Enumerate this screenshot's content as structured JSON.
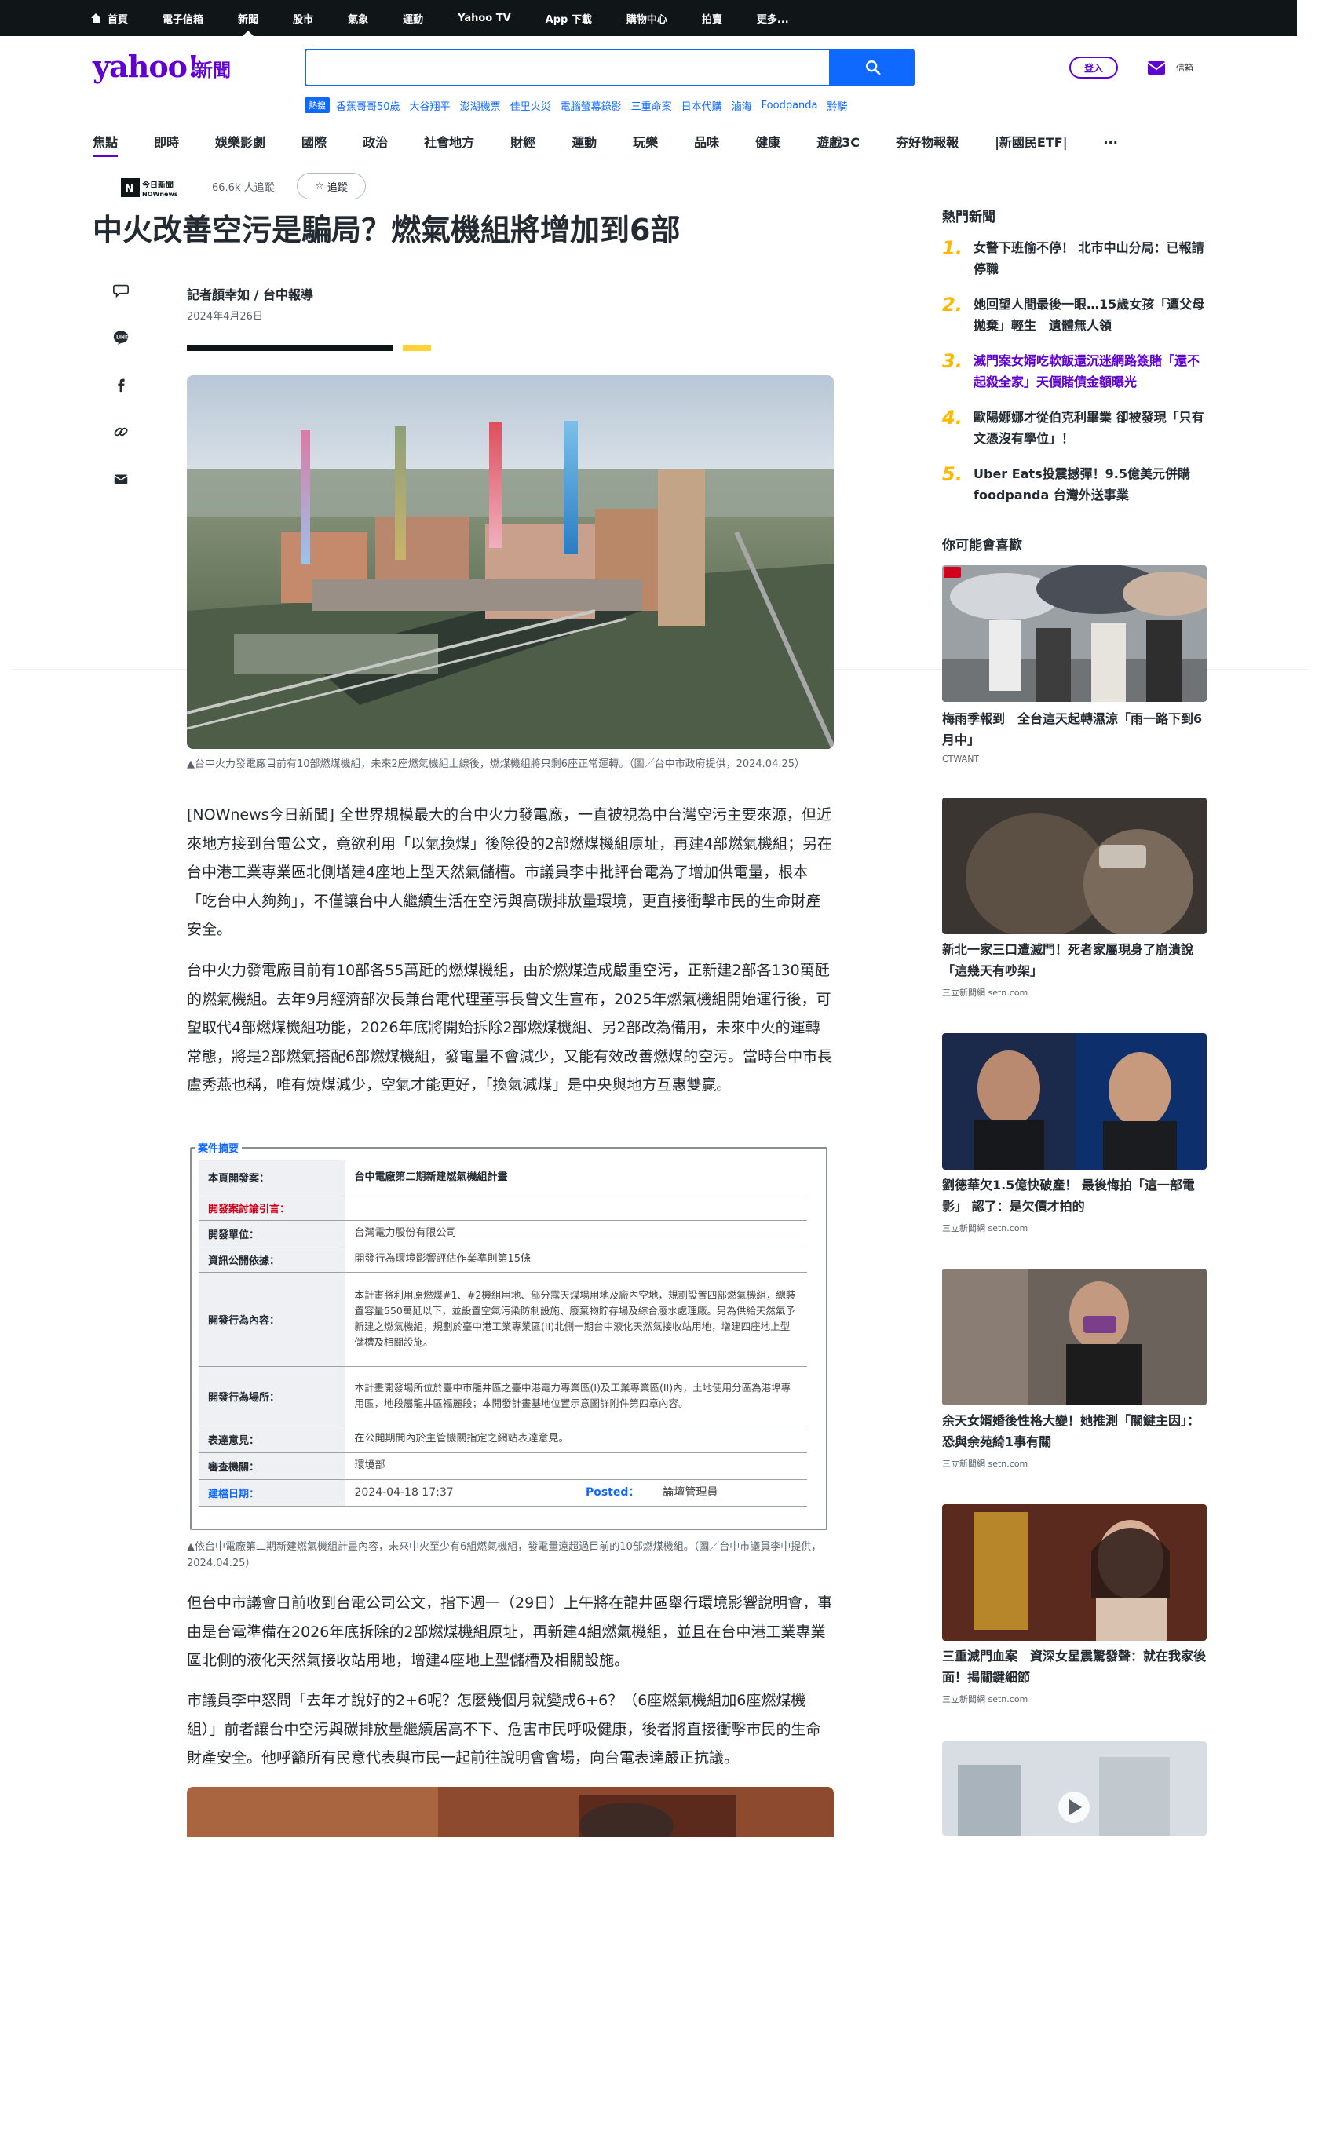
{
  "topnav": {
    "items": [
      "首頁",
      "電子信箱",
      "新聞",
      "股市",
      "氣象",
      "運動",
      "Yahoo TV",
      "App 下載",
      "購物中心",
      "拍賣",
      "更多..."
    ],
    "active_index": 2
  },
  "header": {
    "logo": "yahoo!",
    "logo_sub": "新聞",
    "search_placeholder": "",
    "login": "登入",
    "mail_label": "信箱"
  },
  "trending": {
    "badge": "熱搜",
    "items": [
      "香蕉哥哥50歲",
      "大谷翔平",
      "澎湖機票",
      "佳里火災",
      "電腦螢幕錄影",
      "三重命案",
      "日本代購",
      "滷海",
      "Foodpanda",
      "黔騎"
    ]
  },
  "categories": {
    "items": [
      "焦點",
      "即時",
      "娛樂影劇",
      "國際",
      "政治",
      "社會地方",
      "財經",
      "運動",
      "玩樂",
      "品味",
      "健康",
      "遊戲3C",
      "夯好物報報",
      "|新國民ETF|",
      "..."
    ],
    "active_index": 0
  },
  "article": {
    "publisher": "今日新聞 NOWnews",
    "followers": "66.6k 人追蹤",
    "follow_label": "追蹤",
    "headline": "中火改善空污是騙局？燃氣機組將增加到6部",
    "byline": "記者顏幸如 / 台中報導",
    "date": "2024年4月26日",
    "hero_caption": "▲台中火力發電廠目前有10部燃煤機組，未來2座燃氣機組上線後，燃煤機組將只剩6座正常運轉。（圖／台中市政府提供，2024.04.25）",
    "p1": "[NOWnews今日新聞] 全世界規模最大的台中火力發電廠，一直被視為中台灣空污主要來源，但近來地方接到台電公文，竟欲利用「以氣換煤」後除役的2部燃煤機組原址，再建4部燃氣機組；另在台中港工業專業區北側增建4座地上型天然氣儲槽。市議員李中批評台電為了增加供電量，根本「吃台中人夠夠」，不僅讓台中人繼續生活在空污與高碳排放量環境，更直接衝擊市民的生命財產安全。",
    "p2": "台中火力發電廠目前有10部各55萬瓩的燃煤機組，由於燃煤造成嚴重空污，正新建2部各130萬瓩的燃氣機組。去年9月經濟部次長兼台電代理董事長曾文生宣布，2025年燃氣機組開始運行後，可望取代4部燃煤機組功能，2026年底將開始拆除2部燃煤機組、另2部改為備用，未來中火的運轉常態，將是2部燃氣搭配6部燃煤機組，發電量不會減少，又能有效改善燃煤的空污。當時台中市長盧秀燕也稱，唯有燒煤減少，空氣才能更好，「換氣減煤」是中央與地方互惠雙贏。",
    "figure_label": "案件摘要",
    "table": {
      "r1_k": "本頁開發案：",
      "r1_v": "台中電廠第二期新建燃氣機組計畫",
      "r2_k": "開發案討論引言：",
      "r2_v": "",
      "r3_k": "開發單位：",
      "r3_v": "台灣電力股份有限公司",
      "r4_k": "資訊公開依據：",
      "r4_v": "開發行為環境影響評估作業準則第15條",
      "r5_k": "開發行為內容：",
      "r5_v": "本計畫將利用原燃煤#1、#2機組用地、部分露天煤場用地及廠內空地，規劃設置四部燃氣機組，總裝置容量550萬瓩以下，並設置空氣污染防制設施、廢棄物貯存場及綜合廢水處理廠。另為供給天然氣予新建之燃氣機組，規劃於臺中港工業專業區(II)北側一期台中液化天然氣接收站用地，增建四座地上型儲槽及相關設施。",
      "r6_k": "開發行為場所：",
      "r6_v": "本計畫開發場所位於臺中市龍井區之臺中港電力專業區(I)及工業專業區(II)內，土地使用分區為港埠專用區，地段屬龍井區福麗段；本開發計畫基地位置示意圖詳附件第四章內容。",
      "r7_k": "表達意見：",
      "r7_v": "在公開期間內於主管機關指定之網站表達意見。",
      "r8_k": "審查機關：",
      "r8_v": "環境部",
      "r9_k": "建檔日期：",
      "r9_v": "2024-04-18 17:37",
      "r9_posted": "Posted：",
      "r9_posted_v": "論壇管理員"
    },
    "figure_caption": "▲依台中電廠第二期新建燃氣機組計畫內容，未來中火至少有6組燃氣機組，發電量遠超過目前的10部燃煤機組。（圖／台中市議員李中提供，2024.04.25）",
    "p3": "但台中市議會日前收到台電公司公文，指下週一（29日）上午將在龍井區舉行環境影響說明會，事由是台電準備在2026年底拆除的2部燃煤機組原址，再新建4組燃氣機組，並且在台中港工業專業區北側的液化天然氣接收站用地，增建4座地上型儲槽及相關設施。",
    "p4": "市議員李中怒問「去年才說好的2+6呢？怎麼幾個月就變成6+6？（6座燃氣機組加6座燃煤機組）」前者讓台中空污與碳排放量繼續居高不下、危害市民呼吸健康，後者將直接衝擊市民的生命財產安全。他呼籲所有民意代表與市民一起前往說明會會場，向台電表達嚴正抗議。"
  },
  "sidebar": {
    "hot_title": "熱門新聞",
    "hot": [
      {
        "num": "1.",
        "text": "女警下班偷不停！ 北市中山分局：已報請停職"
      },
      {
        "num": "2.",
        "text": "她回望人間最後一眼…15歲女孩「遭父母拋棄」輕生　遺體無人領"
      },
      {
        "num": "3.",
        "text": "滅門案女婿吃軟飯還沉迷網路簽賭「還不起殺全家」天價賭債金額曝光"
      },
      {
        "num": "4.",
        "text": "歐陽娜娜才從伯克利畢業 卻被發現「只有文憑沒有學位」！"
      },
      {
        "num": "5.",
        "text": "Uber Eats投震撼彈！9.5億美元併購foodpanda 台灣外送事業"
      }
    ],
    "rec_title": "你可能會喜歡",
    "recs": [
      {
        "title": "梅雨季報到　全台這天起轉濕涼「雨一路下到6月中」",
        "source": "CTWANT"
      },
      {
        "title": "新北一家三口遭滅門！死者家屬現身了崩潰說「這幾天有吵架」",
        "source": "三立新聞網 setn.com"
      },
      {
        "title": "劉德華欠1.5億快破產！ 最後悔拍「這一部電影」 認了：是欠債才拍的",
        "source": "三立新聞網 setn.com"
      },
      {
        "title": "余天女婿婚後性格大變！她推測「關鍵主因」：恐與余苑綺1事有關",
        "source": "三立新聞網 setn.com"
      },
      {
        "title": "三重滅門血案　資深女星震驚發聲：就在我家後面！揭關鍵細節",
        "source": "三立新聞網 setn.com"
      }
    ]
  },
  "colors": {
    "brand_purple": "#6001d2",
    "search_blue": "#0f69ff",
    "topnav_bg": "#101518",
    "rank_yellow": "#ffb800"
  }
}
